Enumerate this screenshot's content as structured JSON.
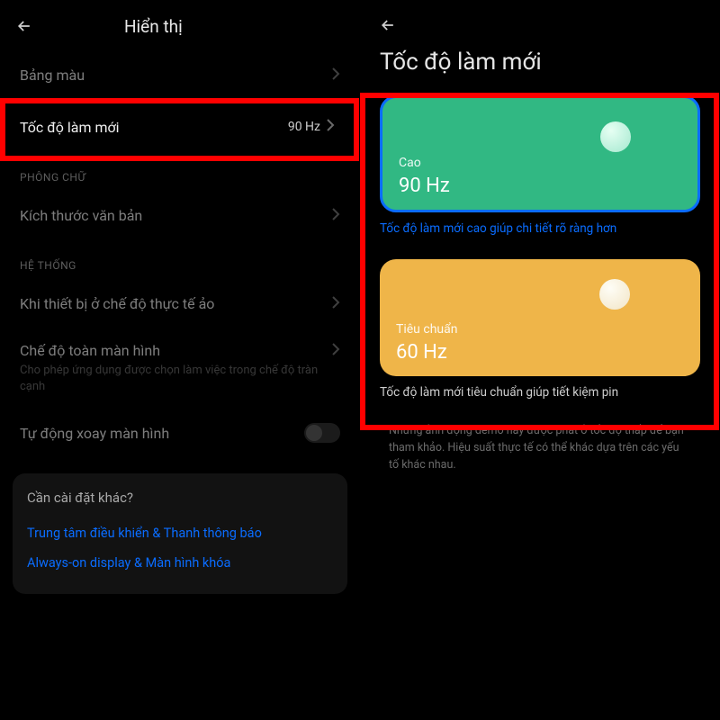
{
  "left": {
    "header_title": "Hiển thị",
    "rows": {
      "color_scheme": {
        "label": "Bảng màu"
      },
      "refresh_rate": {
        "label": "Tốc độ làm mới",
        "value": "90 Hz"
      }
    },
    "sections": {
      "font": "PHÔNG CHỮ",
      "system": "HỆ THỐNG"
    },
    "text_size": {
      "label": "Kích thước văn bản"
    },
    "vr_mode": {
      "label": "Khi thiết bị ở chế độ thực tế ảo"
    },
    "fullscreen": {
      "label": "Chế độ toàn màn hình",
      "subtitle": "Cho phép ứng dụng được chọn làm việc trong chế độ tràn cạnh"
    },
    "autorotate": {
      "label": "Tự động xoay màn hình"
    },
    "other_card": {
      "title": "Cần cài đặt khác?",
      "link1": "Trung tâm điều khiển & Thanh thông báo",
      "link2": "Always-on display & Màn hình khóa"
    }
  },
  "right": {
    "title": "Tốc độ làm mới",
    "high": {
      "label": "Cao",
      "hz": "90 Hz",
      "note": "Tốc độ làm mới cao giúp chi tiết rõ ràng hơn"
    },
    "std": {
      "label": "Tiêu chuẩn",
      "hz": "60 Hz",
      "note": "Tốc độ làm mới tiêu chuẩn giúp tiết kiệm pin"
    },
    "demo_note": "Những ảnh động demo này được phát ở tốc độ thấp để bạn tham khảo. Hiệu suất thực tế có thể khác dựa trên các yếu tố khác nhau."
  }
}
